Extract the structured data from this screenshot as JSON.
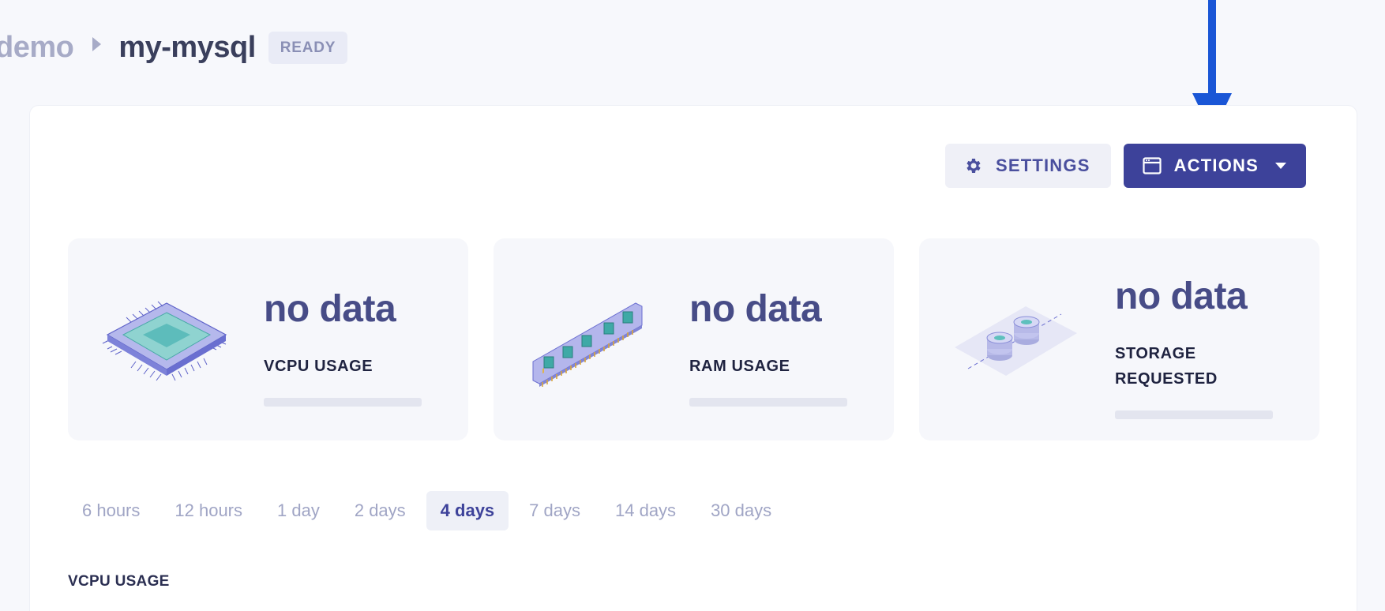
{
  "breadcrumb": {
    "parent": "demo",
    "current": "my-mysql",
    "status": "READY"
  },
  "toolbar": {
    "settings_label": "SETTINGS",
    "actions_label": "ACTIONS",
    "settings_icon": "gear-icon",
    "actions_icon": "window-icon",
    "accent_color": "#3d429a"
  },
  "cards": [
    {
      "value": "no data",
      "label": "VCPU USAGE",
      "icon": "cpu-chip-illustration"
    },
    {
      "value": "no data",
      "label": "RAM USAGE",
      "icon": "ram-module-illustration"
    },
    {
      "value": "no data",
      "label": "STORAGE REQUESTED",
      "icon": "storage-disks-illustration"
    }
  ],
  "ranges": {
    "items": [
      "6 hours",
      "12 hours",
      "1 day",
      "2 days",
      "4 days",
      "7 days",
      "14 days",
      "30 days"
    ],
    "selected": "4 days"
  },
  "section_title": "VCPU USAGE",
  "annotation": {
    "icon": "down-arrow-annotation",
    "color": "#1a56d6"
  }
}
